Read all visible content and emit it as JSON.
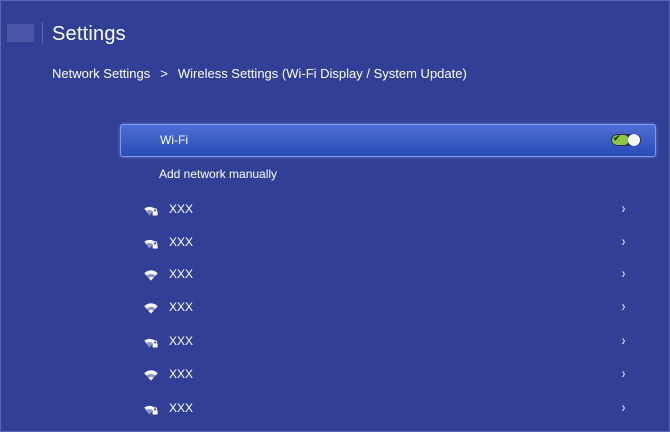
{
  "header": {
    "title": "Settings",
    "breadcrumb": {
      "parent": "Network Settings",
      "separator": ">",
      "current": "Wireless Settings (Wi-Fi Display / System Update)"
    }
  },
  "wifi": {
    "label": "Wi-Fi",
    "enabled": true
  },
  "add_network": {
    "label": "Add network manually"
  },
  "networks": [
    {
      "name": "XXX",
      "icon": "wifi-lock-icon",
      "chevron": "›"
    },
    {
      "name": "XXX",
      "icon": "wifi-lock-icon",
      "chevron": "›"
    },
    {
      "name": "XXX",
      "icon": "wifi-icon",
      "chevron": "›"
    },
    {
      "name": "XXX",
      "icon": "wifi-icon",
      "chevron": "›"
    },
    {
      "name": "XXX",
      "icon": "wifi-lock-icon",
      "chevron": "›"
    },
    {
      "name": "XXX",
      "icon": "wifi-icon",
      "chevron": "›"
    },
    {
      "name": "XXX",
      "icon": "wifi-lock-icon",
      "chevron": "›"
    }
  ],
  "colors": {
    "background": "#323f97",
    "highlight": "#3d5cc8",
    "toggle_on": "#8cc63f",
    "text": "#ffffff"
  }
}
